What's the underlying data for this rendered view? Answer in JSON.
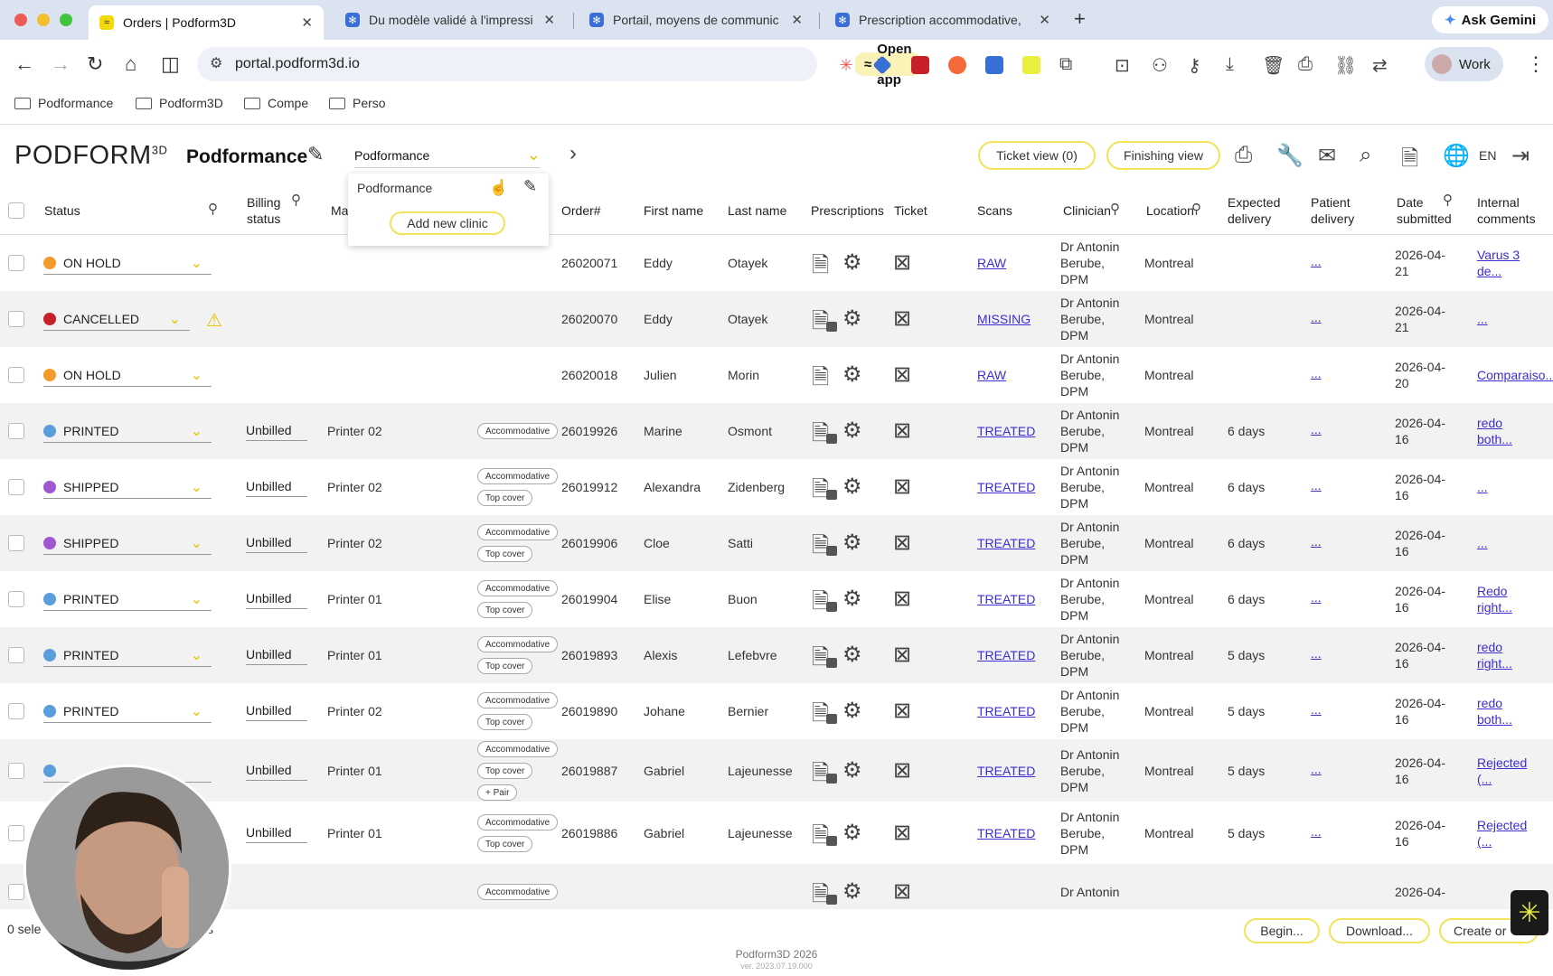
{
  "browser": {
    "tabs": [
      {
        "title": "Orders | Podform3D",
        "active": true
      },
      {
        "title": "Du modèle validé à l'impressi",
        "active": false
      },
      {
        "title": "Portail, moyens de communic",
        "active": false
      },
      {
        "title": "Prescription accommodative,",
        "active": false
      }
    ],
    "ask_gemini": "Ask Gemini",
    "url": "portal.podform3d.io",
    "open_in_app": "Open in app",
    "profile": "Work",
    "bookmarks": [
      "Podformance",
      "Podform3D",
      "Compe",
      "Perso"
    ]
  },
  "app": {
    "logo": "PODFORM",
    "logo_sup": "3D",
    "clinic_title": "Podformance",
    "clinic_select": "Podformance",
    "dropdown_option": "Podformance",
    "add_new_clinic": "Add new clinic",
    "ticket_view": "Ticket view (0)",
    "finishing_view": "Finishing view",
    "lang": "EN"
  },
  "columns": {
    "status": "Status",
    "billing": "Billing status",
    "ma": "Ma",
    "order": "Order#",
    "first": "First name",
    "last": "Last name",
    "prescriptions": "Prescriptions",
    "ticket": "Ticket",
    "scans": "Scans",
    "clinician": "Clinician",
    "location": "Location",
    "expected": "Expected delivery",
    "patient": "Patient delivery",
    "date": "Date submitted",
    "comments": "Internal comments"
  },
  "rows": [
    {
      "status": "ON HOLD",
      "color": "#f39a2b",
      "billing": "",
      "printer": "",
      "badges": [],
      "order": "26020071",
      "first": "Eddy",
      "last": "Otayek",
      "scan": "RAW",
      "clin": [
        "Dr Antonin",
        "Berube,",
        "DPM"
      ],
      "loc": "Montreal",
      "exp": "",
      "pd": "...",
      "date": [
        "2026-04-",
        "21"
      ],
      "comment": [
        "Varus 3",
        "de..."
      ],
      "warn": false,
      "lock": false
    },
    {
      "status": "CANCELLED",
      "color": "#c8202b",
      "billing": "",
      "printer": "",
      "badges": [],
      "order": "26020070",
      "first": "Eddy",
      "last": "Otayek",
      "scan": "MISSING",
      "clin": [
        "Dr Antonin",
        "Berube,",
        "DPM"
      ],
      "loc": "Montreal",
      "exp": "",
      "pd": "...",
      "date": [
        "2026-04-",
        "21"
      ],
      "comment": [
        "..."
      ],
      "warn": true,
      "lock": true
    },
    {
      "status": "ON HOLD",
      "color": "#f39a2b",
      "billing": "",
      "printer": "",
      "badges": [],
      "order": "26020018",
      "first": "Julien",
      "last": "Morin",
      "scan": "RAW",
      "clin": [
        "Dr Antonin",
        "Berube,",
        "DPM"
      ],
      "loc": "Montreal",
      "exp": "",
      "pd": "...",
      "date": [
        "2026-04-",
        "20"
      ],
      "comment": [
        "Comparaiso..."
      ],
      "warn": false,
      "lock": false
    },
    {
      "status": "PRINTED",
      "color": "#5a9fdc",
      "billing": "Unbilled",
      "printer": "Printer 02",
      "badges": [
        "Accommodative"
      ],
      "order": "26019926",
      "first": "Marine",
      "last": "Osmont",
      "scan": "TREATED",
      "clin": [
        "Dr Antonin",
        "Berube,",
        "DPM"
      ],
      "loc": "Montreal",
      "exp": "6 days",
      "pd": "...",
      "date": [
        "2026-04-",
        "16"
      ],
      "comment": [
        "redo",
        "both..."
      ],
      "warn": false,
      "lock": true
    },
    {
      "status": "SHIPPED",
      "color": "#a058d0",
      "billing": "Unbilled",
      "printer": "Printer 02",
      "badges": [
        "Accommodative",
        "Top cover"
      ],
      "order": "26019912",
      "first": "Alexandra",
      "last": "Zidenberg",
      "scan": "TREATED",
      "clin": [
        "Dr Antonin",
        "Berube,",
        "DPM"
      ],
      "loc": "Montreal",
      "exp": "6 days",
      "pd": "...",
      "date": [
        "2026-04-",
        "16"
      ],
      "comment": [
        "..."
      ],
      "warn": false,
      "lock": true
    },
    {
      "status": "SHIPPED",
      "color": "#a058d0",
      "billing": "Unbilled",
      "printer": "Printer 02",
      "badges": [
        "Accommodative",
        "Top cover"
      ],
      "order": "26019906",
      "first": "Cloe",
      "last": "Satti",
      "scan": "TREATED",
      "clin": [
        "Dr Antonin",
        "Berube,",
        "DPM"
      ],
      "loc": "Montreal",
      "exp": "6 days",
      "pd": "...",
      "date": [
        "2026-04-",
        "16"
      ],
      "comment": [
        "..."
      ],
      "warn": false,
      "lock": true
    },
    {
      "status": "PRINTED",
      "color": "#5a9fdc",
      "billing": "Unbilled",
      "printer": "Printer 01",
      "badges": [
        "Accommodative",
        "Top cover"
      ],
      "order": "26019904",
      "first": "Elise",
      "last": "Buon",
      "scan": "TREATED",
      "clin": [
        "Dr Antonin",
        "Berube,",
        "DPM"
      ],
      "loc": "Montreal",
      "exp": "6 days",
      "pd": "...",
      "date": [
        "2026-04-",
        "16"
      ],
      "comment": [
        "Redo",
        "right..."
      ],
      "warn": false,
      "lock": true
    },
    {
      "status": "PRINTED",
      "color": "#5a9fdc",
      "billing": "Unbilled",
      "printer": "Printer 01",
      "badges": [
        "Accommodative",
        "Top cover"
      ],
      "order": "26019893",
      "first": "Alexis",
      "last": "Lefebvre",
      "scan": "TREATED",
      "clin": [
        "Dr Antonin",
        "Berube,",
        "DPM"
      ],
      "loc": "Montreal",
      "exp": "5 days",
      "pd": "...",
      "date": [
        "2026-04-",
        "16"
      ],
      "comment": [
        "redo",
        "right..."
      ],
      "warn": false,
      "lock": true
    },
    {
      "status": "PRINTED",
      "color": "#5a9fdc",
      "billing": "Unbilled",
      "printer": "Printer 02",
      "badges": [
        "Accommodative",
        "Top cover"
      ],
      "order": "26019890",
      "first": "Johane",
      "last": "Bernier",
      "scan": "TREATED",
      "clin": [
        "Dr Antonin",
        "Berube,",
        "DPM"
      ],
      "loc": "Montreal",
      "exp": "5 days",
      "pd": "...",
      "date": [
        "2026-04-",
        "16"
      ],
      "comment": [
        "redo",
        "both..."
      ],
      "warn": false,
      "lock": true
    },
    {
      "status": "",
      "color": "#5a9fdc",
      "billing": "Unbilled",
      "printer": "Printer 01",
      "badges": [
        "Accommodative",
        "Top cover",
        "+ Pair"
      ],
      "order": "26019887",
      "first": "Gabriel",
      "last": "Lajeunesse",
      "scan": "TREATED",
      "clin": [
        "Dr Antonin",
        "Berube,",
        "DPM"
      ],
      "loc": "Montreal",
      "exp": "5 days",
      "pd": "...",
      "date": [
        "2026-04-",
        "16"
      ],
      "comment": [
        "Rejected",
        "(..."
      ],
      "warn": false,
      "lock": true
    },
    {
      "status": "",
      "color": "#5a9fdc",
      "billing": "Unbilled",
      "printer": "Printer 01",
      "badges": [
        "Accommodative",
        "Top cover"
      ],
      "order": "26019886",
      "first": "Gabriel",
      "last": "Lajeunesse",
      "scan": "TREATED",
      "clin": [
        "Dr Antonin",
        "Berube,",
        "DPM"
      ],
      "loc": "Montreal",
      "exp": "5 days",
      "pd": "...",
      "date": [
        "2026-04-",
        "16"
      ],
      "comment": [
        "Rejected",
        "(..."
      ],
      "warn": false,
      "lock": true
    },
    {
      "status": "",
      "color": "#5a9fdc",
      "billing": "",
      "printer": "",
      "badges": [
        "Accommodative"
      ],
      "order": "",
      "first": "",
      "last": "",
      "scan": "",
      "clin": [
        "Dr Antonin"
      ],
      "loc": "",
      "exp": "",
      "pd": "",
      "date": [
        "2026-04-"
      ],
      "comment": [],
      "warn": false,
      "lock": true
    }
  ],
  "footer": {
    "selected": "0 sele",
    "results": "lts",
    "begin": "Begin...",
    "download": "Download...",
    "create": "Create or",
    "copyright": "Podform3D 2026",
    "version": "ver. 2023.07.19.000"
  }
}
